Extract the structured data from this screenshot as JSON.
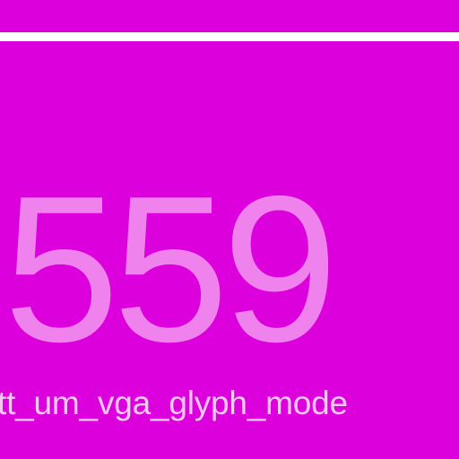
{
  "screen": {
    "value": "559",
    "label": "tt_um_vga_glyph_mode"
  },
  "colors": {
    "background": "#dc00dc",
    "divider": "#ffffff",
    "number": "#f082ee",
    "label": "#f6c8f6"
  }
}
